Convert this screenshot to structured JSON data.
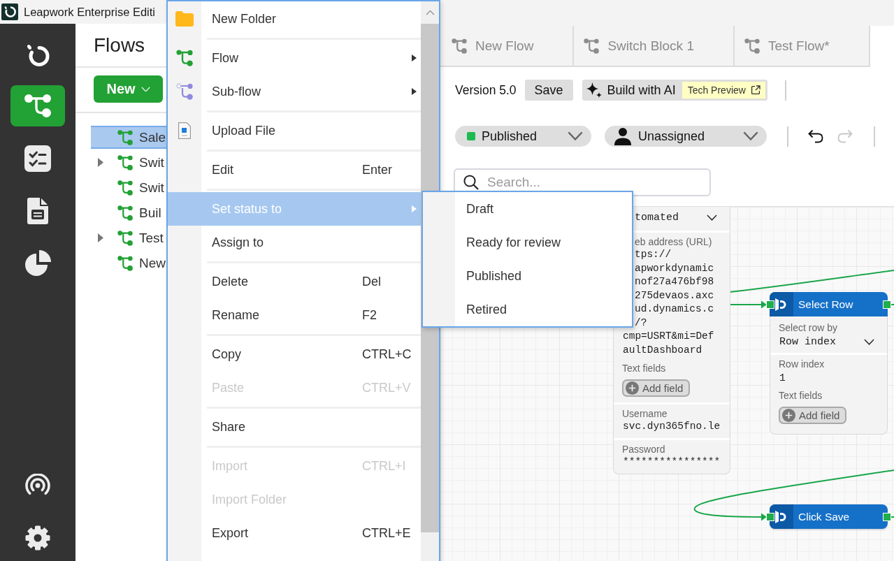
{
  "window": {
    "title": "Leapwork Enterprise Editi"
  },
  "nav": {
    "items": [
      {
        "kind": "tree",
        "selected": true
      },
      {
        "kind": "checklist",
        "selected": false
      },
      {
        "kind": "document",
        "selected": false
      },
      {
        "kind": "pie",
        "selected": false
      }
    ],
    "bottom_items": [
      {
        "kind": "broadcast",
        "selected": false
      },
      {
        "kind": "gear",
        "selected": false
      }
    ]
  },
  "flows_panel": {
    "title": "Flows",
    "new_button": "New",
    "tree": [
      {
        "label": "Sale",
        "expandable": false,
        "selected": true
      },
      {
        "label": "Swit",
        "expandable": true,
        "selected": false
      },
      {
        "label": "Swit",
        "expandable": false,
        "selected": false
      },
      {
        "label": "Buil",
        "expandable": false,
        "selected": false
      },
      {
        "label": "Test",
        "expandable": true,
        "selected": false
      },
      {
        "label": "New",
        "expandable": false,
        "selected": false
      }
    ]
  },
  "context_menu": {
    "sections": [
      [
        {
          "kind": "folder",
          "label": "New Folder",
          "submenu": false,
          "disabled": false,
          "selected": false
        }
      ],
      [
        {
          "kind": "flow",
          "label": "Flow",
          "submenu": true,
          "disabled": false,
          "selected": false
        },
        {
          "kind": "subflow",
          "label": "Sub-flow",
          "submenu": true,
          "disabled": false,
          "selected": false
        }
      ],
      [
        {
          "kind": "file",
          "label": "Upload File",
          "submenu": false,
          "disabled": false,
          "selected": false
        }
      ],
      [
        {
          "kind": "plain",
          "label": "Edit",
          "shortcut": "Enter",
          "submenu": false,
          "disabled": false,
          "selected": false
        }
      ],
      [
        {
          "kind": "plain",
          "label": "Set status to",
          "submenu": true,
          "disabled": false,
          "selected": true
        },
        {
          "kind": "plain",
          "label": "Assign to",
          "submenu": false,
          "disabled": false,
          "selected": false
        }
      ],
      [
        {
          "kind": "plain",
          "label": "Delete",
          "shortcut": "Del",
          "submenu": false,
          "disabled": false,
          "selected": false
        },
        {
          "kind": "plain",
          "label": "Rename",
          "shortcut": "F2",
          "submenu": false,
          "disabled": false,
          "selected": false
        }
      ],
      [
        {
          "kind": "plain",
          "label": "Copy",
          "shortcut": "CTRL+C",
          "submenu": false,
          "disabled": false,
          "selected": false
        },
        {
          "kind": "plain",
          "label": "Paste",
          "shortcut": "CTRL+V",
          "submenu": false,
          "disabled": true,
          "selected": false
        }
      ],
      [
        {
          "kind": "plain",
          "label": "Share",
          "submenu": false,
          "disabled": false,
          "selected": false
        }
      ],
      [
        {
          "kind": "plain",
          "label": "Import",
          "shortcut": "CTRL+I",
          "submenu": false,
          "disabled": true,
          "selected": false
        },
        {
          "kind": "plain",
          "label": "Import Folder",
          "submenu": false,
          "disabled": true,
          "selected": false
        },
        {
          "kind": "plain",
          "label": "Export",
          "shortcut": "CTRL+E",
          "submenu": false,
          "disabled": false,
          "selected": false
        }
      ]
    ]
  },
  "status_submenu": {
    "items": [
      "Draft",
      "Ready for review",
      "Published",
      "Retired"
    ]
  },
  "tabs": [
    {
      "label": "New Flow",
      "selected": false
    },
    {
      "label": "Switch Block 1",
      "selected": false
    },
    {
      "label": "Test Flow*",
      "selected": false
    },
    {
      "selected": true
    }
  ],
  "toolbar": {
    "version": "Version 5.0",
    "save_button": "Save",
    "ai_button": {
      "label": "Build with AI",
      "badge": "Tech Preview"
    },
    "status": {
      "label": "Published",
      "color": "#1dbb4f"
    },
    "assignee": "Unassigned",
    "undo": {
      "disabled": false
    },
    "redo": {
      "disabled": true
    }
  },
  "search": {
    "placeholder": "Search..."
  },
  "canvas": {
    "blocks": [
      {
        "kind": "form",
        "sections": [
          {
            "kind": "dropdown",
            "value": "tomated"
          },
          {
            "kind": "multiline",
            "label": "eb address (URL)",
            "lines": [
              "tps://",
              "apworkdynamic",
              "nof27a476bf98",
              "275devaos.axc",
              "ud.dynamics.c",
              "/?",
              "cmp=USRT&mi=Def",
              "aultDashboard"
            ],
            "fields_label": "Text fields",
            "add_button": "Add field"
          },
          {
            "kind": "value",
            "label": "Username",
            "value": "svc.dyn365fno.le"
          },
          {
            "kind": "value",
            "label": "Password",
            "value": "****************"
          }
        ]
      },
      {
        "kind": "step",
        "title": "Select Row",
        "sections": [
          {
            "kind": "dropdown",
            "label": "Select row by",
            "value": "Row index"
          },
          {
            "kind": "value",
            "label": "Row index",
            "value": "1",
            "fields_label": "Text fields",
            "add_button": "Add field"
          }
        ]
      },
      {
        "kind": "step",
        "title": "Click Save"
      }
    ]
  }
}
